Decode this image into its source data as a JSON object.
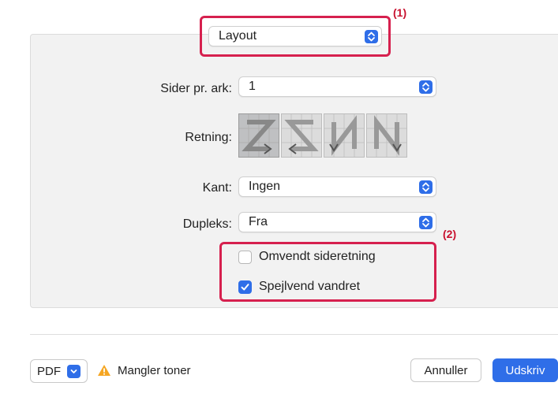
{
  "callouts": {
    "one": "(1)",
    "two": "(2)"
  },
  "layout_popup": {
    "value": "Layout"
  },
  "pages_per_sheet": {
    "label": "Sider pr. ark:",
    "value": "1"
  },
  "orientation": {
    "label": "Retning:",
    "options": [
      "z-left-right",
      "reverse-z",
      "n-reverse",
      "n-top-bottom"
    ]
  },
  "border": {
    "label": "Kant:",
    "value": "Ingen"
  },
  "duplex": {
    "label": "Dupleks:",
    "value": "Fra"
  },
  "checkboxes": [
    {
      "label": "Omvendt sideretning",
      "checked": false
    },
    {
      "label": "Spejlvend vandret",
      "checked": true
    }
  ],
  "footer": {
    "pdf_label": "PDF",
    "warning_text": "Mangler toner",
    "cancel_label": "Annuller",
    "print_label": "Udskriv"
  },
  "colors": {
    "accent": "#2f6ee8",
    "highlight": "#d6204e",
    "warning": "#f5a623"
  }
}
